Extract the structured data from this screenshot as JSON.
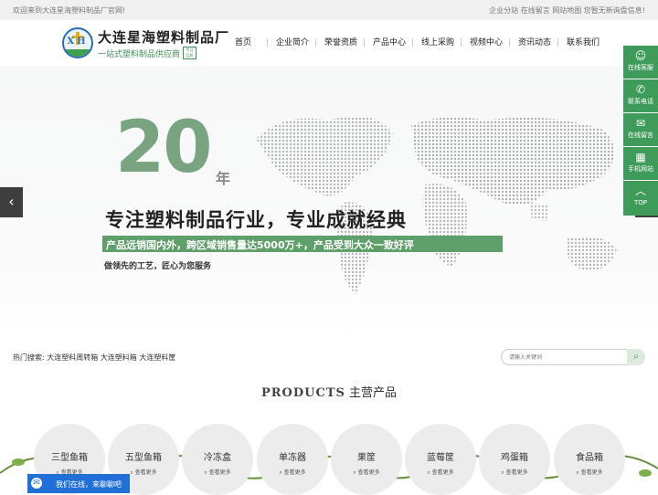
{
  "topbar": {
    "welcome": "欢迎来到大连星海塑料制品厂官网!",
    "right_links": "企业分站 在线留言 网站地图 您暂无新询盘信息!"
  },
  "header": {
    "brand": "大连星海塑料制品厂",
    "slogan": "一站式塑料制品供应商",
    "logo_text": "XH",
    "slogan_badge": "专注 品质"
  },
  "nav": [
    "首页",
    "企业简介",
    "荣誉资质",
    "产品中心",
    "线上采购",
    "视频中心",
    "资讯动态",
    "联系我们"
  ],
  "hero": {
    "big_number": "20",
    "unit": "年",
    "headline": "专注塑料制品行业，专业成就经典",
    "band_text": "产品远销国内外，跨区域销售量达5000万+，产品受到大众一致好评",
    "subline": "做领先的工艺，匠心为您服务",
    "prev_icon": "chevron-left-icon",
    "next_icon": "chevron-right-icon"
  },
  "side_tools": [
    {
      "icon": "chat-icon",
      "label": "在线客服"
    },
    {
      "icon": "phone-icon",
      "label": "联系电话"
    },
    {
      "icon": "message-icon",
      "label": "在线留言"
    },
    {
      "icon": "qrcode-icon",
      "label": "手机网站"
    },
    {
      "icon": "arrow-up-icon",
      "label": "TOP"
    }
  ],
  "search": {
    "hot_label": "热门搜索:",
    "hot_terms": "大连塑料周转箱 大连塑料箱 大连塑料筐",
    "placeholder": "请输入关键词"
  },
  "section": {
    "title_en": "PRODUCTS",
    "title_cn": "主营产品"
  },
  "categories": [
    {
      "name": "三型鱼箱",
      "more": "查看更多"
    },
    {
      "name": "五型鱼箱",
      "more": "查看更多"
    },
    {
      "name": "冷冻盒",
      "more": "查看更多"
    },
    {
      "name": "单冻器",
      "more": "查看更多"
    },
    {
      "name": "果筐",
      "more": "查看更多"
    },
    {
      "name": "蓝莓筐",
      "more": "查看更多"
    },
    {
      "name": "鸡蛋箱",
      "more": "查看更多"
    },
    {
      "name": "食品箱",
      "more": "查看更多"
    }
  ],
  "chat": {
    "text": "我们在线，来聊聊吧"
  },
  "colors": {
    "accent": "#3f9b5a",
    "band": "#5f9f6a",
    "chat": "#1f6fd6"
  }
}
